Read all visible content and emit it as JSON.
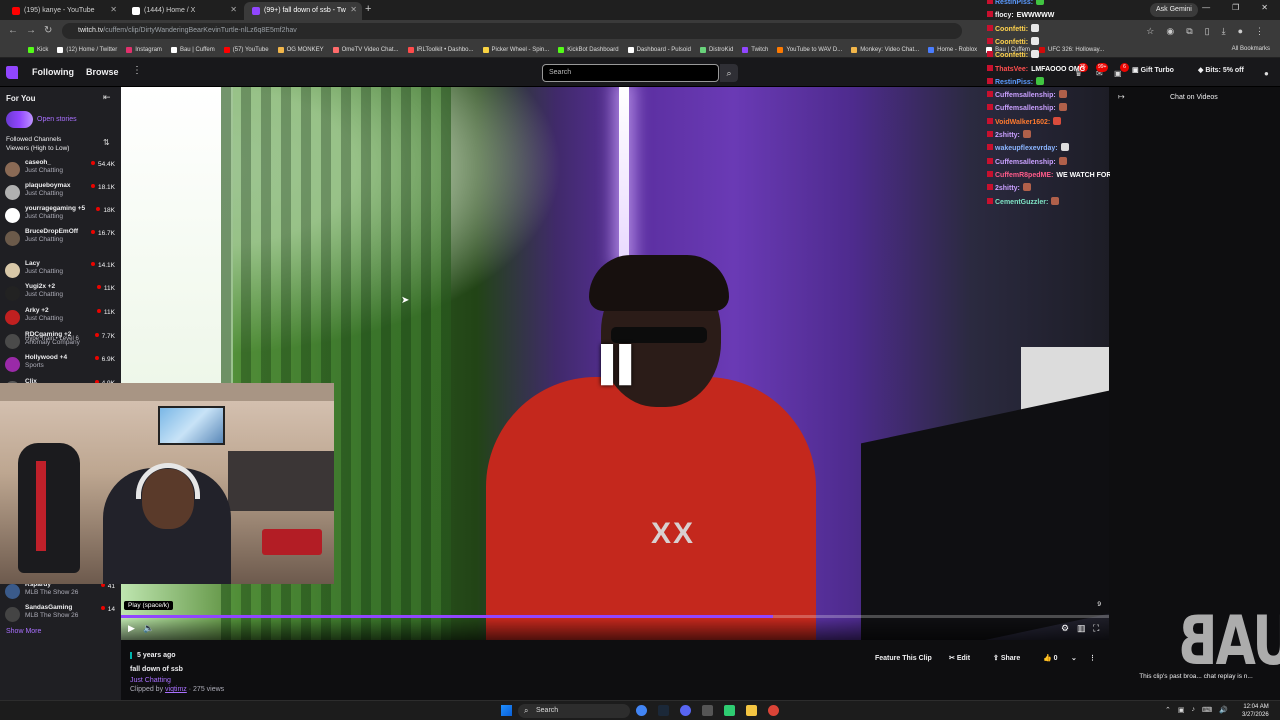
{
  "browser": {
    "tabs": [
      {
        "title": "(195) kanye - YouTube",
        "favicon_color": "#ff0000"
      },
      {
        "title": "(1444) Home / X",
        "favicon_color": "#ffffff"
      },
      {
        "title": "(99+) fall down of ssb - Tw",
        "favicon_color": "#9146ff"
      }
    ],
    "url_host": "twitch.tv",
    "url_path": "/cuffem/clip/DirtyWanderingBearKevinTurtle-nlLz6q8E5mf2hav",
    "ask_gemini": "Ask Gemini",
    "bookmarks": [
      {
        "label": "Kick",
        "color": "#53fc18"
      },
      {
        "label": "(12) Home / Twitter",
        "color": "#ffffff"
      },
      {
        "label": "Instagram",
        "color": "#e1306c"
      },
      {
        "label": "Bau | Cuffem",
        "color": "#ffffff"
      },
      {
        "label": "(57) YouTube",
        "color": "#ff0000"
      },
      {
        "label": "OG MONKEY",
        "color": "#f2b64a"
      },
      {
        "label": "OmeTV Video Chat...",
        "color": "#ff6b6b"
      },
      {
        "label": "IRLToolkit • Dashbo...",
        "color": "#ff4b4b"
      },
      {
        "label": "Picker Wheel - Spin...",
        "color": "#f9d342"
      },
      {
        "label": "KickBot Dashboard",
        "color": "#53fc18"
      },
      {
        "label": "Dashboard - Pulsoid",
        "color": "#ffffff"
      },
      {
        "label": "DistroKid",
        "color": "#69d37b"
      },
      {
        "label": "Twitch",
        "color": "#9146ff"
      },
      {
        "label": "YouTube to WAV D...",
        "color": "#ff7a00"
      },
      {
        "label": "Monkey: Video Chat...",
        "color": "#f2b64a"
      },
      {
        "label": "Home - Roblox",
        "color": "#4a7dff"
      },
      {
        "label": "Bau | Cuffem",
        "color": "#ffffff"
      },
      {
        "label": "UFC 326: Holloway...",
        "color": "#d20a0a"
      }
    ],
    "all_bookmarks": "All Bookmarks"
  },
  "twitch_nav": {
    "following": "Following",
    "browse": "Browse",
    "search_placeholder": "Search",
    "badge_a": "36",
    "badge_b": "99+",
    "badge_c": "6",
    "gift_turbo": "Gift Turbo",
    "bits": "Bits: 5% off"
  },
  "sidebar": {
    "heading": "For You",
    "stories": "Open stories",
    "followed_title": "Followed Channels",
    "followed_sort": "Viewers (High to Low)",
    "channels": [
      {
        "name": "caseoh_",
        "game": "Just Chatting",
        "viewers": "54.4K",
        "color": "#8a6a55"
      },
      {
        "name": "plaqueboymax",
        "game": "Just Chatting",
        "viewers": "18.1K",
        "color": "#b0b0b0"
      },
      {
        "name": "yourragegaming +5",
        "game": "Just Chatting",
        "viewers": "18K",
        "color": "#ffffff"
      },
      {
        "name": "BruceDropEmOff",
        "game": "Just Chatting",
        "viewers": "16.7K",
        "color": "#6b5a4a"
      },
      {
        "name": "Lacy",
        "game": "Just Chatting",
        "viewers": "14.1K",
        "color": "#d8c8a8"
      },
      {
        "name": "Yugi2x +2",
        "game": "Just Chatting",
        "viewers": "11K",
        "color": "#222222"
      },
      {
        "name": "Arky +2",
        "game": "Just Chatting",
        "viewers": "11K",
        "color": "#c02020"
      },
      {
        "name": "RDCgaming +2",
        "game": "Anomaly Company",
        "viewers": "7.7K",
        "color": "#4a4a4a"
      },
      {
        "name": "Hollywood +4",
        "game": "Sports",
        "viewers": "6.9K",
        "color": "#9a2aa8"
      }
    ],
    "hype_train": "Hype Train • Level 6",
    "partial_channel": {
      "name": "Clix",
      "viewers": "4.9K"
    },
    "bottom_channels": [
      {
        "name": "Rspardy",
        "game": "MLB The Show 26",
        "viewers": "41",
        "color": "#3a5a8a"
      },
      {
        "name": "SandasGaming",
        "game": "MLB The Show 26",
        "viewers": "14",
        "color": "#444444"
      }
    ],
    "show_more": "Show More"
  },
  "player": {
    "tooltip": "Play (space/k)",
    "duration_mark": "9",
    "progress": 0.66,
    "shirt_text": "XX"
  },
  "chat": {
    "lines": [
      {
        "user": "RestinPiss:",
        "color": "#5b9bff",
        "msg": "",
        "emote": "#41c441"
      },
      {
        "user": "flocy:",
        "color": "#efeff1",
        "msg": "EWWWWW",
        "emote": ""
      },
      {
        "user": "Coonfetti:",
        "color": "#ffd24d",
        "msg": "",
        "emote": "#e8e8e8"
      },
      {
        "user": "Coonfetti:",
        "color": "#ffd24d",
        "msg": "",
        "emote": "#e8e8e8"
      },
      {
        "user": "Coonfetti:",
        "color": "#ffd24d",
        "msg": "",
        "emote": "#e8e8e8"
      },
      {
        "user": "ThatsVee:",
        "color": "#ff4f4f",
        "msg": "LMFAOOO OMG",
        "emote": ""
      },
      {
        "user": "RestinPiss:",
        "color": "#5b9bff",
        "msg": "",
        "emote": "#41c441"
      },
      {
        "user": "Cuffemsallenship:",
        "color": "#c9a0ff",
        "msg": "",
        "emote": "#b0604a"
      },
      {
        "user": "Cuffemsallenship:",
        "color": "#c9a0ff",
        "msg": "",
        "emote": "#b0604a"
      },
      {
        "user": "VoidWalker1602:",
        "color": "#ff7a2f",
        "msg": "",
        "emote": "#d94c3c"
      },
      {
        "user": "2shitty:",
        "color": "#c9a0ff",
        "msg": "",
        "emote": "#b0604a"
      },
      {
        "user": "wakeupflexevrday:",
        "color": "#8ab4ff",
        "msg": "",
        "emote": "#dddddd"
      },
      {
        "user": "Cuffemsallenship:",
        "color": "#c9a0ff",
        "msg": "",
        "emote": "#b0604a"
      },
      {
        "user": "CuffemR8pedME:",
        "color": "#ff5b8a",
        "msg": "WE WATCH FOR MONKEY NOT MUSIC",
        "emote": ""
      },
      {
        "user": "2shitty:",
        "color": "#c9a0ff",
        "msg": "",
        "emote": "#b0604a"
      },
      {
        "user": "CementGuzzler:",
        "color": "#7fe3c4",
        "msg": "",
        "emote": "#b0604a"
      }
    ]
  },
  "right_panel": {
    "header": "Chat on Videos",
    "note": "This clip's past broa... chat replay is n...",
    "watermark": "UAB"
  },
  "clip_info": {
    "ago": "5 years ago",
    "title": "fall down of ssb",
    "category": "Just Chatting",
    "clipped_by_prefix": "Clipped by",
    "clipper": "viqtimz",
    "views": "· 275 views",
    "feature": "Feature This Clip",
    "edit": "Edit",
    "share": "Share",
    "likes": "0"
  },
  "taskbar": {
    "search": "Search",
    "time": "12:04 AM",
    "date": "3/27/2026"
  }
}
